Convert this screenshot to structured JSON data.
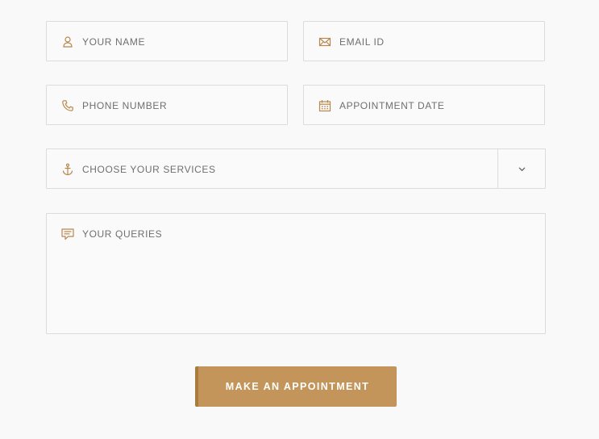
{
  "form": {
    "name_field": {
      "placeholder": "YOUR NAME",
      "icon": "user-icon"
    },
    "email_field": {
      "placeholder": "EMAIL ID",
      "icon": "envelope-icon"
    },
    "phone_field": {
      "placeholder": "PHONE NUMBER",
      "icon": "phone-icon"
    },
    "date_field": {
      "placeholder": "APPOINTMENT DATE",
      "icon": "calendar-icon"
    },
    "services_select": {
      "selected": "CHOOSE YOUR SERVICES",
      "icon": "anchor-icon",
      "arrow_icon": "chevron-down-icon"
    },
    "queries_field": {
      "placeholder": "YOUR QUERIES",
      "icon": "comment-icon"
    },
    "submit_label": "MAKE AN APPOINTMENT"
  },
  "colors": {
    "accent": "#c4955a",
    "accent_dark": "#a87b3f",
    "icon": "#b8874d",
    "border": "#dcdcdc",
    "text": "#6f6f6f",
    "background": "#f9f9f9"
  }
}
